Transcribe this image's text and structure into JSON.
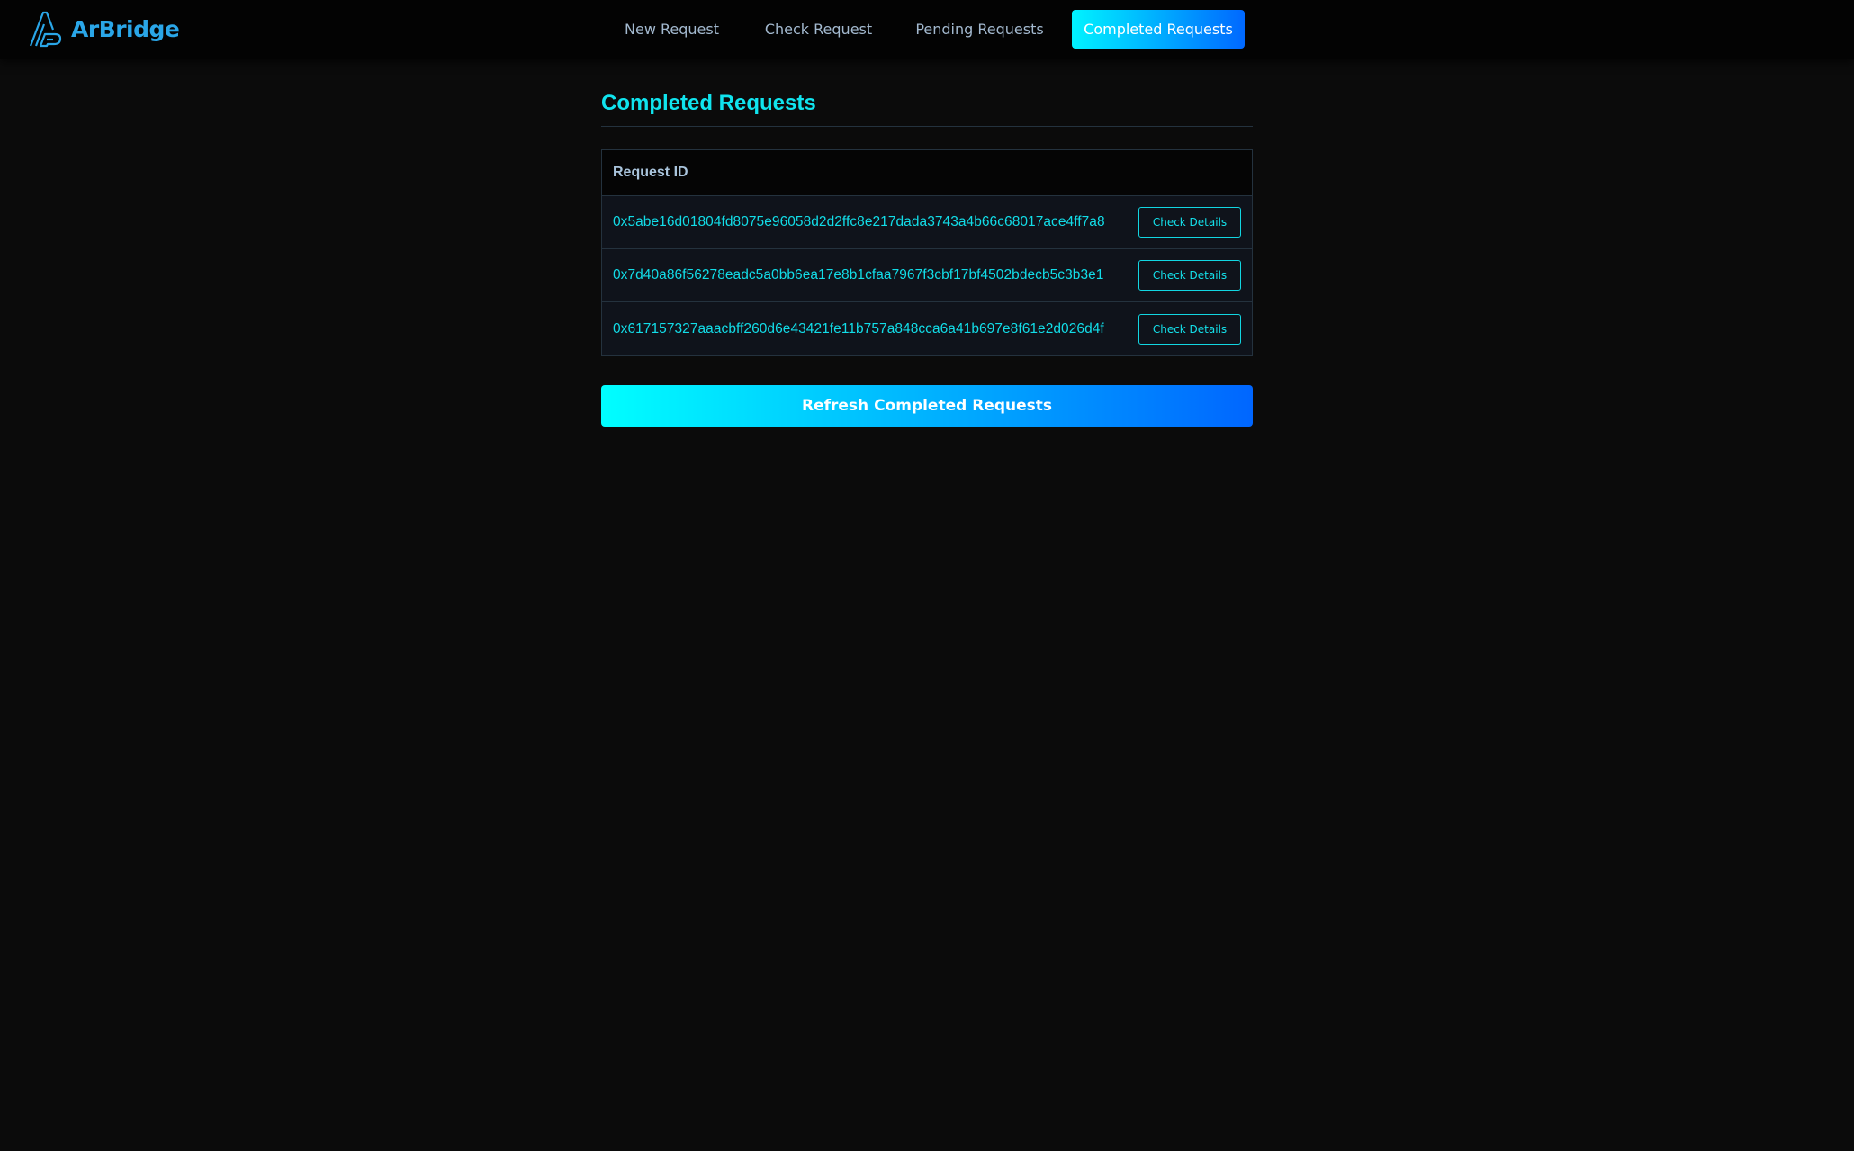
{
  "app": {
    "name": "ArBridge",
    "logo_icon": "arbridge-logo-icon"
  },
  "nav": {
    "items": [
      {
        "label": "New Request",
        "active": false
      },
      {
        "label": "Check Request",
        "active": false
      },
      {
        "label": "Pending Requests",
        "active": false
      },
      {
        "label": "Completed Requests",
        "active": true
      }
    ]
  },
  "main": {
    "title": "Completed Requests",
    "table": {
      "columns": [
        "Request ID"
      ],
      "rows": [
        {
          "id": "0x5abe16d01804fd8075e96058d2d2ffc8e217dada3743a4b66c68017ace4ff7a8",
          "action": "Check Details"
        },
        {
          "id": "0x7d40a86f56278eadc5a0bb6ea17e8b1cfaa7967f3cbf17bf4502bdecb5c3b3e1",
          "action": "Check Details"
        },
        {
          "id": "0x617157327aaacbff260d6e43421fe11b757a848cca6a41b697e8f61e2d026d4f",
          "action": "Check Details"
        }
      ]
    },
    "refresh_label": "Refresh Completed Requests"
  },
  "colors": {
    "background": "#0b0b0b",
    "header_bg": "#030303",
    "accent_cyan": "#10e4ee",
    "accent_blue": "#0068ff",
    "logo_blue": "#2aa6e8",
    "nav_text": "#a3b9cf"
  }
}
